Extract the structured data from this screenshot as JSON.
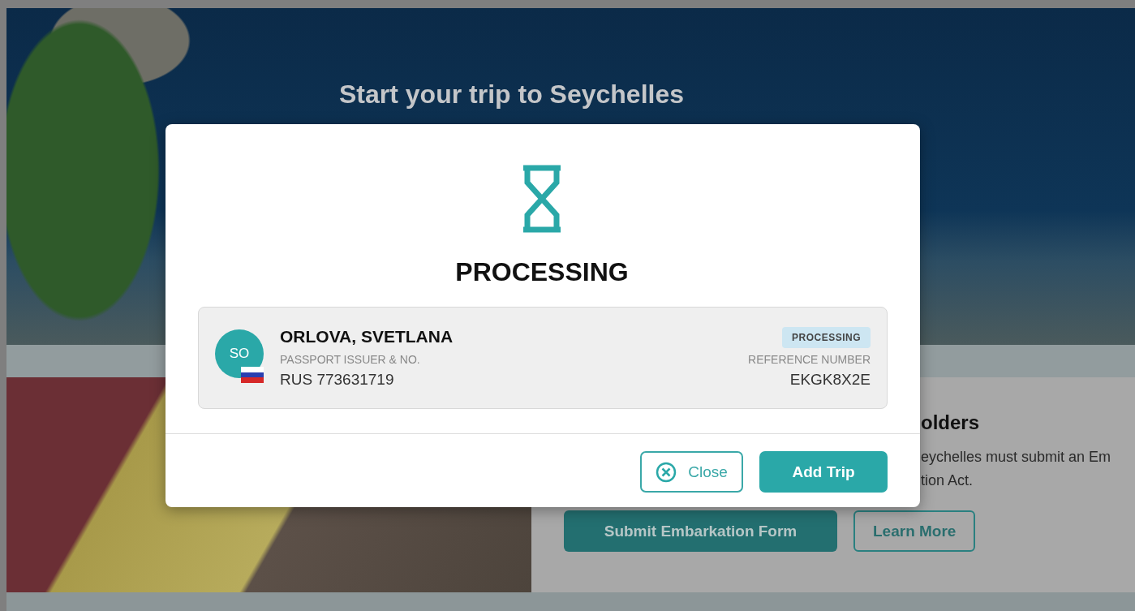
{
  "hero": {
    "title": "Start your trip to Seychelles"
  },
  "info_section": {
    "heading_fragment": "olders",
    "text_lines": [
      "eychelles must submit an Em",
      "tion Act."
    ],
    "buttons": [
      {
        "label": "Submit Embarkation Form",
        "kind": "primary"
      },
      {
        "label": "Learn More",
        "kind": "outline"
      }
    ]
  },
  "dialog": {
    "status_title": "PROCESSING",
    "traveler": {
      "initials": "SO",
      "name": "ORLOVA, SVETLANA",
      "passport_label": "PASSPORT ISSUER & NO.",
      "passport_value": "RUS 773631719",
      "status_badge": "PROCESSING",
      "reference_label": "REFERENCE NUMBER",
      "reference_value": "EKGK8X2E"
    },
    "buttons": [
      {
        "label": "Close",
        "kind": "outline"
      },
      {
        "label": "Add Trip",
        "kind": "primary"
      }
    ]
  }
}
